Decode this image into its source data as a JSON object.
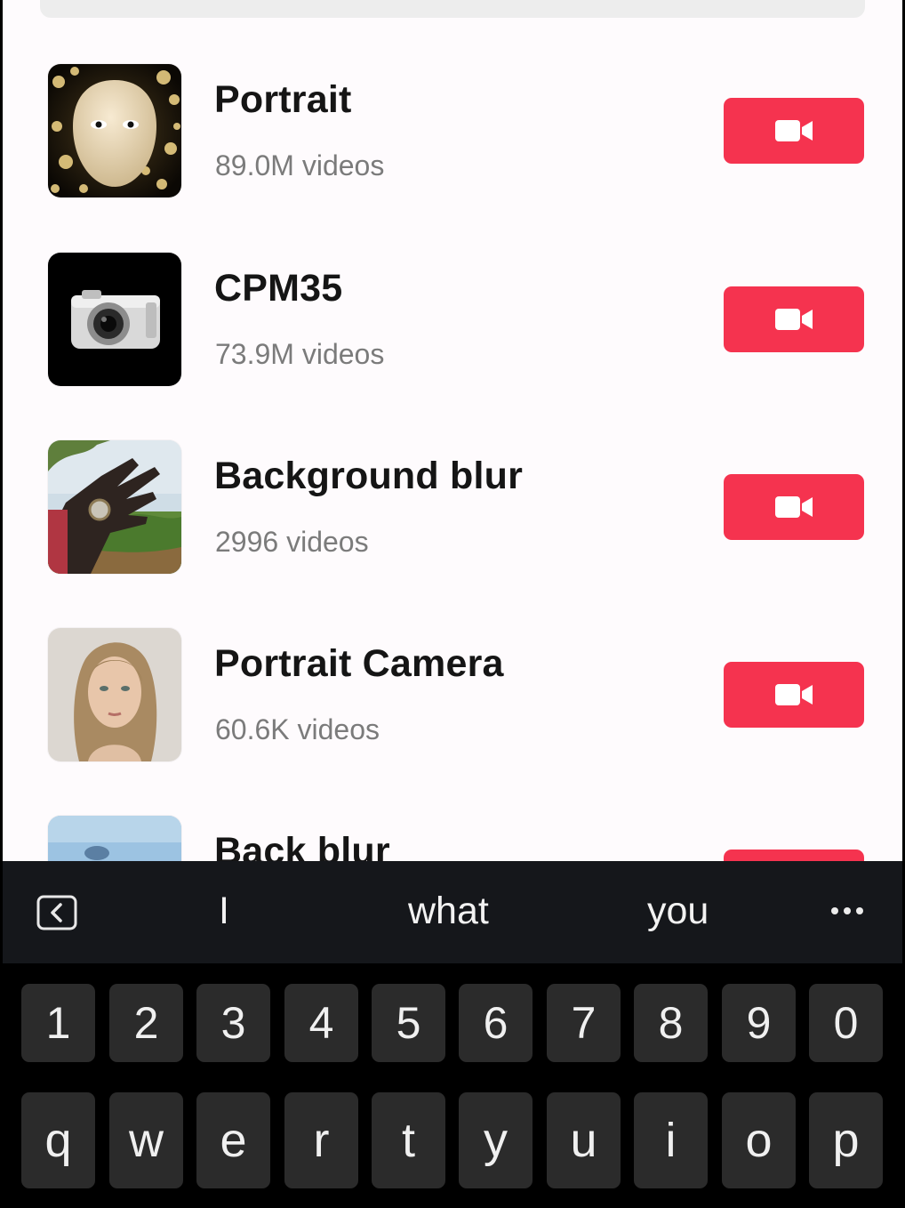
{
  "effects": [
    {
      "name": "Portrait",
      "count": "89.0M videos",
      "thumbnail": "mask-face-bokeh"
    },
    {
      "name": "CPM35",
      "count": "73.9M videos",
      "thumbnail": "film-camera"
    },
    {
      "name": "Background blur",
      "count": "2996 videos",
      "thumbnail": "hand-watch-photo"
    },
    {
      "name": "Portrait Camera",
      "count": "60.6K videos",
      "thumbnail": "woman-portrait"
    },
    {
      "name": "Back blur",
      "count": "",
      "thumbnail": "sky-photo"
    }
  ],
  "record_button_icon": "video-camera-icon",
  "accent_color": "#f5334f",
  "keyboard": {
    "suggestions": [
      "I",
      "what",
      "you"
    ],
    "collapse_icon": "keyboard-collapse-icon",
    "more_icon": "more-dots-icon",
    "number_row": [
      "1",
      "2",
      "3",
      "4",
      "5",
      "6",
      "7",
      "8",
      "9",
      "0"
    ],
    "letter_row": [
      "q",
      "w",
      "e",
      "r",
      "t",
      "y",
      "u",
      "i",
      "o",
      "p"
    ]
  }
}
